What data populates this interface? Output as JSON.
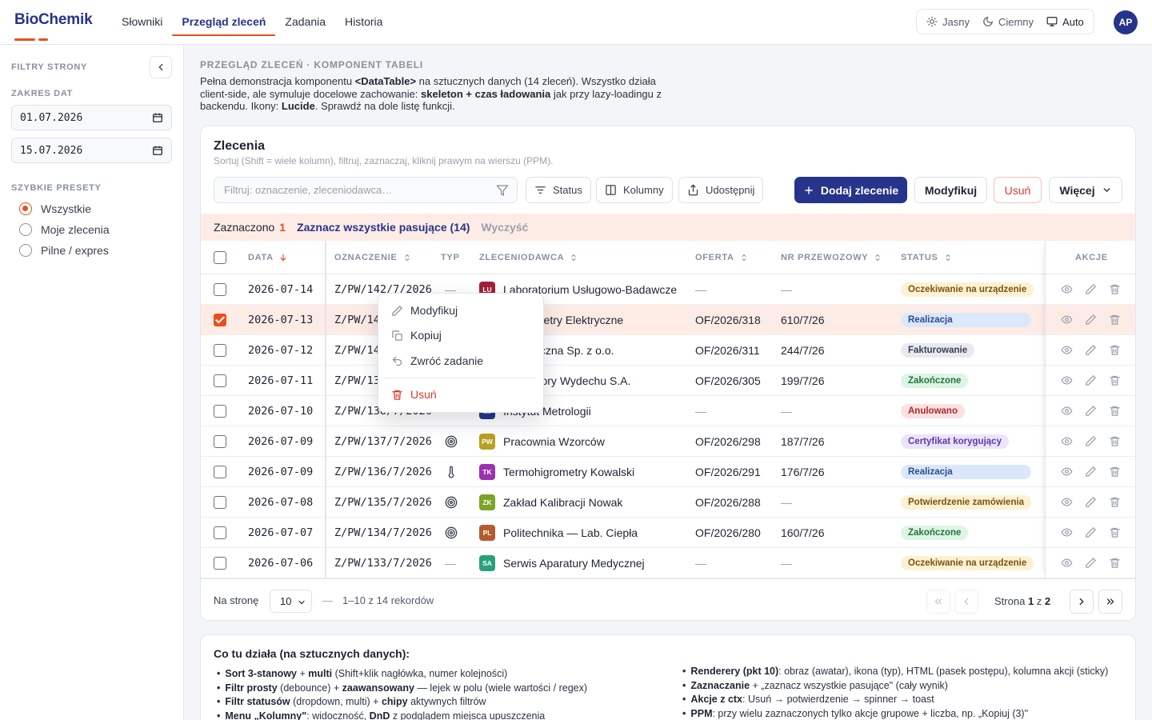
{
  "app": {
    "logo": "BioChemik"
  },
  "nav": {
    "items": [
      "Słowniki",
      "Przegląd zleceń",
      "Zadania",
      "Historia"
    ],
    "active": 1
  },
  "theme": {
    "options": [
      "Jasny",
      "Ciemny",
      "Auto"
    ],
    "active": 2
  },
  "user": {
    "initials": "AP"
  },
  "sidebar": {
    "title": "FILTRY STRONY",
    "date_range_label": "ZAKRES DAT",
    "date_from": "01.07.2026",
    "date_to": "15.07.2026",
    "presets_label": "SZYBKIE PRESETY",
    "presets": [
      "Wszystkie",
      "Moje zlecenia",
      "Pilne / expres"
    ],
    "preset_selected": 0
  },
  "page": {
    "kicker": "PRZEGLĄD ZLECEŃ · KOMPONENT TABELI",
    "desc_1": "Pełna demonstracja komponentu ",
    "desc_2": "<DataTable>",
    "desc_3": " na sztucznych danych (14 zleceń). Wszystko działa client-side, ale symuluje docelowe zachowanie: ",
    "desc_4": "skeleton + czas ładowania",
    "desc_5": " jak przy lazy-loadingu z backendu. Ikony: ",
    "desc_6": "Lucide",
    "desc_7": ". Sprawdź na dole listę funkcji."
  },
  "card": {
    "title": "Zlecenia",
    "subtitle": "Sortuj (Shift = wiele kolumn), filtruj, zaznaczaj, kliknij prawym na wierszu (PPM).",
    "filter_placeholder": "Filtruj: oznaczenie, zleceniodawca…",
    "btn_status": "Status",
    "btn_columns": "Kolumny",
    "btn_share": "Udostępnij",
    "btn_add": "Dodaj zlecenie",
    "btn_modify": "Modyfikuj",
    "btn_delete": "Usuń",
    "btn_more": "Więcej"
  },
  "selection": {
    "label": "Zaznaczono",
    "count": "1",
    "select_all": "Zaznacz wszystkie pasujące (14)",
    "clear": "Wyczyść"
  },
  "columns": [
    "DATA",
    "OZNACZENIE",
    "TYP",
    "ZLECENIODAWCA",
    "OFERTA",
    "NR PRZEWOZOWY",
    "STATUS",
    "AKCJE"
  ],
  "rows": [
    {
      "date": "2026-07-14",
      "code": "Z/PW/142/7/2026",
      "type": "—",
      "client_initials": "LU",
      "client_color": "#a3203a",
      "client": "Laboratorium Usługowo-Badawcze",
      "offer": "—",
      "transport": "—",
      "status": "Oczekiwanie na urządzenie",
      "status_bg": "#fdf1d3",
      "status_fg": "#7a5410",
      "selected": false
    },
    {
      "date": "2026-07-13",
      "code": "Z/PW/141/7/2026",
      "type": "",
      "client_initials": "",
      "client_color": "#27348b",
      "client": "Termometry Elektryczne",
      "offer": "OF/2026/318",
      "transport": "610/7/26",
      "status": "Realizacja",
      "status_bg": "#dbe7fb",
      "status_fg": "#2c4a8c",
      "selected": true
    },
    {
      "date": "2026-07-12",
      "code": "Z/PW/140/7/2026",
      "type": "",
      "client_initials": "",
      "client_color": "#2a8d5e",
      "client": "Klimatyczna Sp. z o.o.",
      "offer": "OF/2026/311",
      "transport": "244/7/26",
      "status": "Fakturowanie",
      "status_bg": "#e8eaef",
      "status_fg": "#3a4052",
      "selected": false
    },
    {
      "date": "2026-07-11",
      "code": "Z/PW/139/7/2026",
      "type": "",
      "client_initials": "",
      "client_color": "#6b46c1",
      "client": "Laboratory Wydechu S.A.",
      "offer": "OF/2026/305",
      "transport": "199/7/26",
      "status": "Zakończone",
      "status_bg": "#dcf5e4",
      "status_fg": "#22743f",
      "selected": false
    },
    {
      "date": "2026-07-10",
      "code": "Z/PW/138/7/2026",
      "type": "",
      "client_initials": "IM",
      "client_color": "#27348b",
      "client": "Instytut Metrologii",
      "offer": "—",
      "transport": "—",
      "status": "Anulowano",
      "status_bg": "#fbe1e1",
      "status_fg": "#b0262a",
      "selected": false
    },
    {
      "date": "2026-07-09",
      "code": "Z/PW/137/7/2026",
      "type": "target",
      "client_initials": "PW",
      "client_color": "#b8a021",
      "client": "Pracownia Wzorców",
      "offer": "OF/2026/298",
      "transport": "187/7/26",
      "status": "Certyfikat korygujący",
      "status_bg": "#ece4fb",
      "status_fg": "#5b3aa5",
      "selected": false
    },
    {
      "date": "2026-07-09",
      "code": "Z/PW/136/7/2026",
      "type": "thermometer",
      "client_initials": "TK",
      "client_color": "#9c32b0",
      "client": "Termohigrometry Kowalski",
      "offer": "OF/2026/291",
      "transport": "176/7/26",
      "status": "Realizacja",
      "status_bg": "#dbe7fb",
      "status_fg": "#2c4a8c",
      "selected": false
    },
    {
      "date": "2026-07-08",
      "code": "Z/PW/135/7/2026",
      "type": "target",
      "client_initials": "ZK",
      "client_color": "#7aa42a",
      "client": "Zakład Kalibracji Nowak",
      "offer": "OF/2026/288",
      "transport": "—",
      "status": "Potwierdzenie zamówienia",
      "status_bg": "#fdf1d3",
      "status_fg": "#7a5410",
      "selected": false
    },
    {
      "date": "2026-07-07",
      "code": "Z/PW/134/7/2026",
      "type": "target",
      "client_initials": "PL",
      "client_color": "#b55a2e",
      "client": "Politechnika — Lab. Ciepła",
      "offer": "OF/2026/280",
      "transport": "160/7/26",
      "status": "Zakończone",
      "status_bg": "#dcf5e4",
      "status_fg": "#22743f",
      "selected": false
    },
    {
      "date": "2026-07-06",
      "code": "Z/PW/133/7/2026",
      "type": "—",
      "client_initials": "SA",
      "client_color": "#2aa07a",
      "client": "Serwis Aparatury Medycznej",
      "offer": "—",
      "transport": "—",
      "status": "Oczekiwanie na urządzenie",
      "status_bg": "#fdf1d3",
      "status_fg": "#7a5410",
      "selected": false
    }
  ],
  "footer": {
    "per_page_label": "Na stronę",
    "per_page": "10",
    "sep": "—",
    "records": "1–10 z 14 rekordów",
    "page_label": "Strona",
    "page": "1",
    "of": "z",
    "pages": "2"
  },
  "context_menu": {
    "items": [
      "Modyfikuj",
      "Kopiuj",
      "Zwróć zadanie",
      "Usuń"
    ]
  },
  "info": {
    "title": "Co tu działa (na sztucznych danych):",
    "left": [
      {
        "b": "Sort 3-stanowy",
        "t1": " + ",
        "b2": "multi",
        "t2": " (Shift+klik nagłówka, numer kolejności)"
      },
      {
        "b": "Filtr prosty",
        "t1": " (debounce) + ",
        "b2": "zaawansowany",
        "t2": " — lejek w polu (wiele wartości / regex)"
      },
      {
        "b": "Filtr statusów",
        "t1": " (dropdown, multi) + ",
        "b2": "chipy",
        "t2": " aktywnych filtrów"
      },
      {
        "b": "Menu „Kolumny\"",
        "t1": ": widoczność, ",
        "b2": "DnD",
        "t2": " z podglądem miejsca upuszczenia"
      }
    ],
    "right": [
      {
        "b": "Renderery (pkt 10)",
        "t1": ": obraz (awatar), ikona (typ), HTML (pasek postępu), kolumna akcji (sticky)",
        "b2": "",
        "t2": ""
      },
      {
        "b": "Zaznaczanie",
        "t1": " + „zaznacz wszystkie pasujące\" (cały wynik)",
        "b2": "",
        "t2": ""
      },
      {
        "b": "Akcje z ctx",
        "t1": ": Usuń → potwierdzenie → spinner → toast",
        "b2": "",
        "t2": ""
      },
      {
        "b": "PPM",
        "t1": ": przy wielu zaznaczonych tylko akcje grupowe + liczba, np. „Kopiuj (3)\"",
        "b2": "",
        "t2": ""
      }
    ]
  }
}
